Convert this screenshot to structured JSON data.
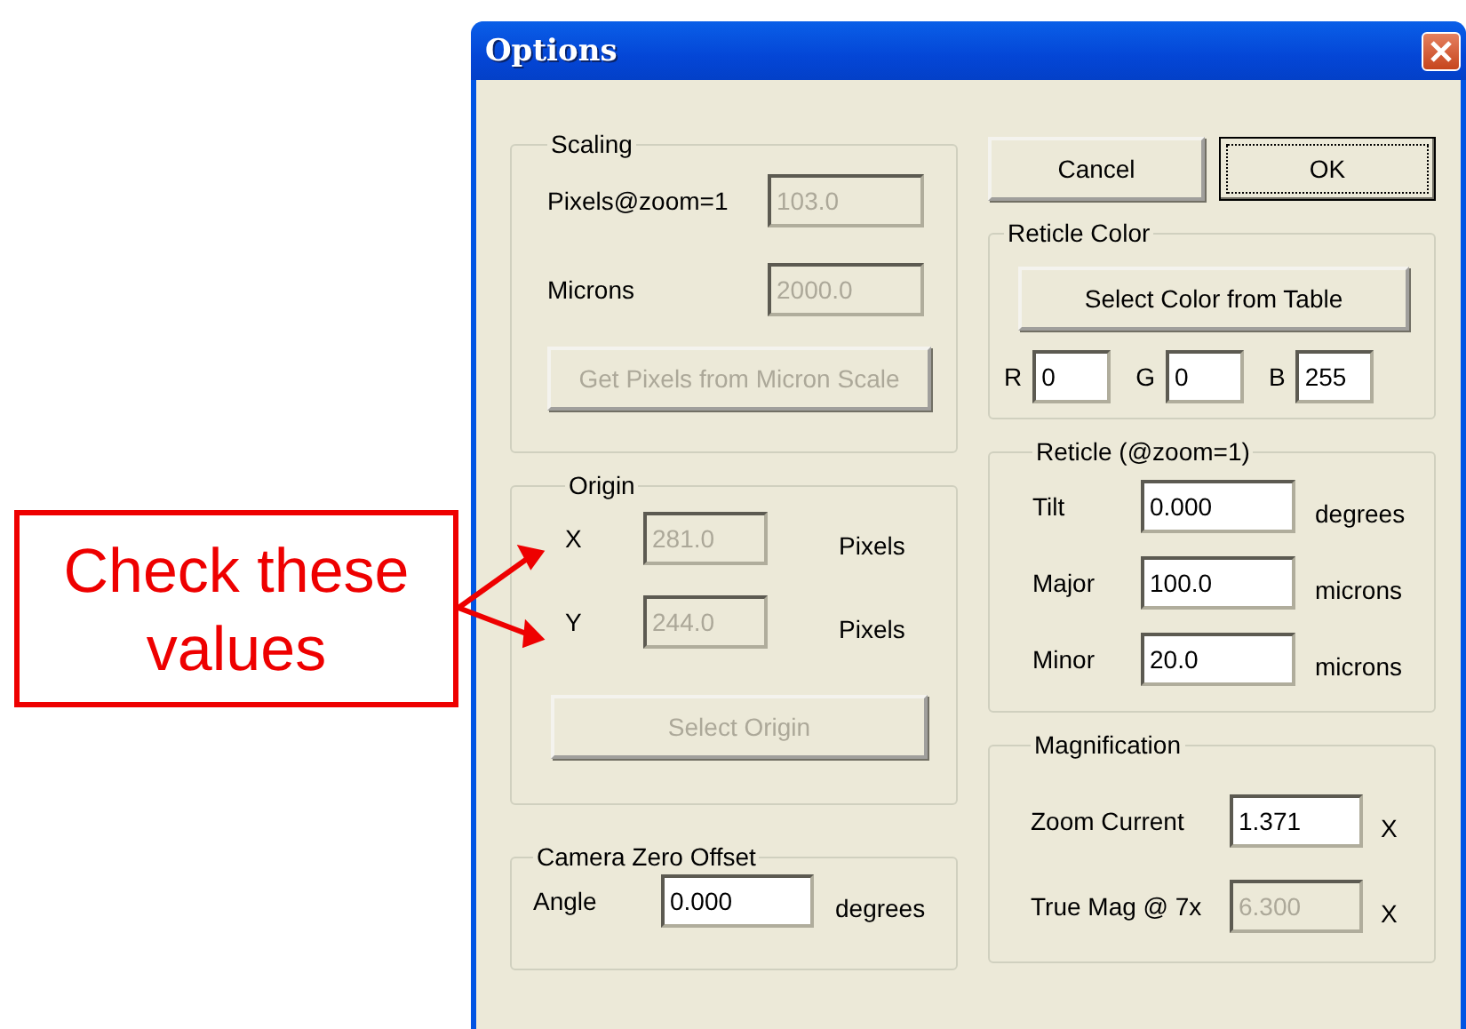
{
  "callout": {
    "text": "Check these values"
  },
  "window": {
    "title": "Options"
  },
  "left_groups": [
    {
      "title": "Scaling",
      "rows": [
        {
          "kind": "field",
          "label": "Pixels@zoom=1",
          "value": "103.0",
          "disabled": true
        },
        {
          "kind": "field",
          "label": "Microns",
          "value": "2000.0",
          "disabled": true
        },
        {
          "kind": "button",
          "label": "Get Pixels from Micron Scale",
          "disabled": true
        }
      ]
    },
    {
      "title": "Origin",
      "rows": [
        {
          "kind": "field",
          "label": "X",
          "value": "281.0",
          "disabled": true,
          "unit": "Pixels"
        },
        {
          "kind": "field",
          "label": "Y",
          "value": "244.0",
          "disabled": true,
          "unit": "Pixels"
        },
        {
          "kind": "button",
          "label": "Select Origin",
          "disabled": true
        }
      ]
    },
    {
      "title": "Camera Zero Offset",
      "rows": [
        {
          "kind": "field",
          "label": "Angle",
          "value": "0.000",
          "disabled": false,
          "unit": "degrees"
        }
      ]
    }
  ],
  "buttons": [
    {
      "label": "Cancel",
      "default": false
    },
    {
      "label": "OK",
      "default": true
    }
  ],
  "right_groups": [
    {
      "title": "Reticle Color",
      "rows": [
        {
          "kind": "button",
          "label": "Select Color from Table",
          "disabled": false
        },
        {
          "kind": "rgb",
          "fields": [
            {
              "label": "R",
              "value": "0"
            },
            {
              "label": "G",
              "value": "0"
            },
            {
              "label": "B",
              "value": "255"
            }
          ]
        }
      ]
    },
    {
      "title": "Reticle (@zoom=1)",
      "rows": [
        {
          "kind": "field",
          "label": "Tilt",
          "value": "0.000",
          "disabled": false,
          "unit": "degrees"
        },
        {
          "kind": "field",
          "label": "Major",
          "value": "100.0",
          "disabled": false,
          "unit": "microns"
        },
        {
          "kind": "field",
          "label": "Minor",
          "value": "20.0",
          "disabled": false,
          "unit": "microns"
        }
      ]
    },
    {
      "title": "Magnification",
      "rows": [
        {
          "kind": "field",
          "label": "Zoom Current",
          "value": "1.371",
          "disabled": false,
          "unit": "X"
        },
        {
          "kind": "field",
          "label": "True Mag @ 7x",
          "value": "6.300",
          "disabled": true,
          "unit": "X"
        }
      ]
    }
  ]
}
